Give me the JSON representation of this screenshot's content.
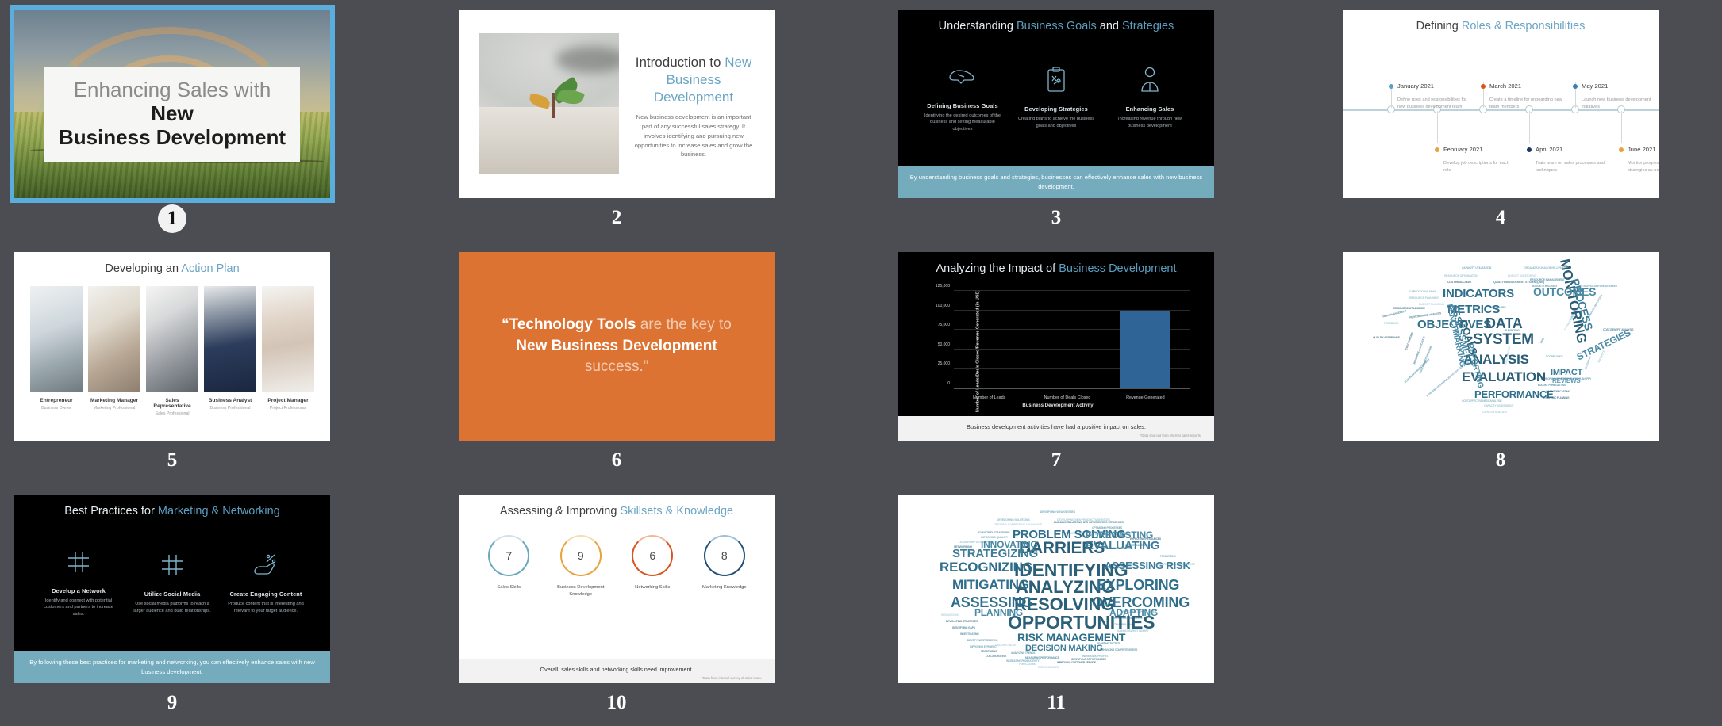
{
  "app": {
    "view": "slide-sorter",
    "background_color": "#4b4d53",
    "selection_color": "#5badde",
    "accent_color": "#6ba5c4",
    "banner_color": "#74abbd",
    "orange_color": "#dd7333"
  },
  "slides": [
    {
      "number": "1",
      "selected": true,
      "type": "title-photo",
      "title_line1_plain": "Enhancing Sales with ",
      "title_line1_bold": "New",
      "title_line2": "Business Development"
    },
    {
      "number": "2",
      "selected": false,
      "type": "image-text",
      "title_plain": "Introduction to ",
      "title_accent1": "New",
      "title_accent2": "Business Development",
      "body": "New business development is an important part of any successful sales strategy. It involves identifying and pursuing new opportunities to increase sales and grow the business."
    },
    {
      "number": "3",
      "selected": false,
      "type": "dark-three-column",
      "title_plain1": "Understanding ",
      "title_accent1": "Business Goals",
      "title_plain2": " and ",
      "title_accent2": "Strategies",
      "columns": [
        {
          "icon": "handshake-icon",
          "heading": "Defining Business Goals",
          "text": "Identifying the desired outcomes of the business and setting measurable objectives"
        },
        {
          "icon": "clipboard-strategy-icon",
          "heading": "Developing Strategies",
          "text": "Creating plans to achieve the business goals and objectives"
        },
        {
          "icon": "person-tie-icon",
          "heading": "Enhancing Sales",
          "text": "Increasing revenue through new business development"
        }
      ],
      "banner": "By understanding business goals and strategies, businesses can effectively enhance sales with new business development."
    },
    {
      "number": "4",
      "selected": false,
      "type": "timeline",
      "title_plain": "Defining ",
      "title_accent": "Roles & Responsibilities",
      "events": [
        {
          "date": "January 2021",
          "text": "Define roles and responsibilities for new business development team",
          "color": "#5b9ec0",
          "position": "above"
        },
        {
          "date": "February 2021",
          "text": "Develop job descriptions for each role",
          "color": "#e8a33d",
          "position": "below"
        },
        {
          "date": "March 2021",
          "text": "Create a timeline for onboarding new team members",
          "color": "#d9531e",
          "position": "above"
        },
        {
          "date": "April 2021",
          "text": "Train team on sales processes and techniques",
          "color": "#1f3864",
          "position": "below"
        },
        {
          "date": "May 2021",
          "text": "Launch new business development initiatives",
          "color": "#3b7fb5",
          "position": "above"
        },
        {
          "date": "June 2021",
          "text": "Monitor progress and adjust strategies as needed",
          "color": "#e8a33d",
          "position": "below"
        }
      ]
    },
    {
      "number": "5",
      "selected": false,
      "type": "team-grid",
      "title_plain": "Developing an ",
      "title_accent": "Action Plan",
      "people": [
        {
          "name": "Entrepreneur",
          "role": "Business Owner"
        },
        {
          "name": "Marketing Manager",
          "role": "Marketing Professional"
        },
        {
          "name": "Sales Representative",
          "role": "Sales Professional"
        },
        {
          "name": "Business Analyst",
          "role": "Business Professional"
        },
        {
          "name": "Project Manager",
          "role": "Project Professional"
        }
      ]
    },
    {
      "number": "6",
      "selected": false,
      "type": "quote",
      "quote_parts": [
        {
          "text": "“Technology Tools ",
          "bold": true
        },
        {
          "text": "are the key to ",
          "bold": false
        },
        {
          "text": "New Business Development",
          "bold": true
        },
        {
          "text": " success.”",
          "bold": false
        }
      ]
    },
    {
      "number": "7",
      "selected": false,
      "type": "bar-chart",
      "title_plain": "Analyzing the Impact of ",
      "title_accent": "Business Development",
      "footer": "Business development activities have had a positive impact on sales.",
      "footnote": "*Data sourced from internal sales reports."
    },
    {
      "number": "8",
      "selected": false,
      "type": "word-cloud",
      "words_large": [
        "INDICATORS",
        "METRICS",
        "OBJECTIVES",
        "DATA",
        "MONITORING",
        "PROCESS",
        "OUTCOMES",
        "SYSTEM",
        "GOALS",
        "ANALYSIS",
        "EVALUATION",
        "PERFORMANCE",
        "ASSESSMENT",
        "STRATEGIES",
        "IMPACT",
        "BENCHMARKING",
        "REPORTING",
        "REVIEWS"
      ],
      "words_small": [
        "CAPACITY UTILIZATION",
        "ORGANIZATIONAL DEVELOPMENT",
        "RESOURCE OPTIMIZATION",
        "BUDGET MONITORING",
        "COST REDUCTION",
        "QUALITY MANAGEMENT SYSTEM (QMS)",
        "RESOURCE MANAGEMENT",
        "BUDGET TRACKING",
        "STAKEHOLDER ENGAGEMENT",
        "CAPACITY BUILDING",
        "RESOURCE PLANNING",
        "BUDGET PLANNING",
        "RESOURCE UTILIZATION",
        "PERFORMANCE ANALYSIS",
        "RISK MANAGEMENT",
        "MEASURES",
        "PERFORMANCE REPORTING",
        "SURVEYS",
        "FEEDBACK",
        "CAPACITY PLANNING",
        "QUALITY ASSURANCE",
        "COST-BENEFIT ANALYSIS",
        "BUDGETING",
        "KPIS",
        "SCORECARDS",
        "PROGRAMS",
        "PROJECTS",
        "COST ANALYSIS",
        "COST CONTROL",
        "RESOURCE ALLOCATION",
        "COST-BENEFIT ANALYSIS",
        "CONTINUOUS IMPROVEMENT",
        "PERFORMANCE MANAGEMENT SYSTEM (PMS)",
        "COST-EFFECTIVENESS ANALYSIS",
        "CAPACITY ASSESSMENT",
        "CAPACITY BUILDING",
        "STRATEGIC PLANNING",
        "COST FORECASTING",
        "BUDGET FORECASTING",
        "PERFORMANCE IMPROVEMENT PLAN (PIP)"
      ]
    },
    {
      "number": "9",
      "selected": false,
      "type": "dark-three-column",
      "title_plain1": "Best Practices for ",
      "title_accent1": "Marketing & Networking",
      "title_plain2": "",
      "title_accent2": "",
      "columns": [
        {
          "icon": "hashtag-icon",
          "heading": "Develop a Network",
          "text": "Identify and connect with potential customers and partners to increase sales."
        },
        {
          "icon": "hashtag-icon",
          "heading": "Utilize Social Media",
          "text": "Use social media platforms to reach a larger audience and build relationships."
        },
        {
          "icon": "hand-content-icon",
          "heading": "Create Engaging Content",
          "text": "Produce content that is interesting and relevant to your target audience."
        }
      ],
      "banner": "By following these best practices for marketing and networking, you can effectively enhance sales with new business development."
    },
    {
      "number": "10",
      "selected": false,
      "type": "score-rings",
      "title_plain": "Assessing & Improving ",
      "title_accent": "Skillsets & Knowledge",
      "footer": "Overall, sales skills and networking skills need improvement.",
      "footnote": "*Data from internal survey of sales team."
    },
    {
      "number": "11",
      "selected": false,
      "type": "word-cloud",
      "words_large": [
        "PROBLEM SOLVING",
        "BARRIERS",
        "IDENTIFYING",
        "ANALYZING",
        "RESOLVING",
        "OPPORTUNITIES",
        "RECOGNIZING",
        "MITIGATING",
        "ASSESSING",
        "OVERCOMING",
        "EXPLORING",
        "STRATEGIZING",
        "EVALUATING",
        "FORECASTING",
        "ASSESSING RISK",
        "RISK MANAGEMENT",
        "DECISION MAKING",
        "INNOVATING",
        "PLANNING",
        "ADAPTING"
      ],
      "words_small": [
        "IDENTIFYING WEAKNESSES",
        "DEVELOPING SOLUTIONS",
        "DEVELOPING NEW PRODUCTS/SERVICES",
        "CREATING COMPETITIVE ADVANTAGE",
        "BUILDING RELATIONSHIPS",
        "IMPLEMENTING STRATEGIES",
        "ADJUSTING STRATEGIES",
        "OPTIMIZING PROCESSES",
        "IMPROVING QUALITY",
        "INCREASING MARKET SHARE",
        "LEADERSHIP DEVELOPMENT",
        "BRAINSTORMING",
        "EXPLOITING RESOURCES",
        "NETWORKING",
        "IDENTIFYING THREATS",
        "MONITORING PROGRESS",
        "PRIORITIZING",
        "MAXIMIZING BENEFITS",
        "DEVELOPING SKILLS/KNOWLEDGE",
        "RESEARCHING",
        "DEVELOPING STRATEGIES",
        "IDENTIFYING GAPS",
        "INVESTIGATING",
        "IDENTIFYING STRENGTHS",
        "MOTIVATING EMPLOYEES",
        "TEAM BUILDING",
        "GAINING MARKET INSIGHT",
        "CREATING VALUE",
        "NEGOTIATING",
        "ADAPTING TACTICS",
        "COLLABORATING",
        "ENHANCING COMPETITIVENESS",
        "INCREASING PRODUCTIVITY",
        "INCREASING PROFITS",
        "FORECASTING",
        "REDUCING COSTS",
        "IMPROVING CUSTOMER SERVICE",
        "IDENTIFYING OPPORTUNITIES",
        "MEASURING PERFORMANCE",
        "ANALYZING TRENDS",
        "IMPROVING EFFICIENCY",
        "EXPLOITING OPPORTUNITIES",
        "ANTICIPATING"
      ]
    }
  ],
  "chart_data": {
    "type": "bar",
    "title": "Analyzing the Impact of Business Development",
    "categories": [
      "Number of Leads",
      "Number of Deals Closed",
      "Revenue Generated"
    ],
    "values": [
      0,
      0,
      100000
    ],
    "xlabel": "Business Development Activity",
    "ylabel": "Number of Leads/Deals Closed/Revenue Generated (in USD)",
    "ylim": [
      0,
      125000
    ],
    "yticks": [
      "0",
      "25,000",
      "50,000",
      "75,000",
      "100,000",
      "125,000"
    ],
    "bar_color": "#2e6496",
    "grid": true,
    "legend": "none"
  },
  "rings_data": {
    "type": "bar",
    "title": "Assessing & Improving Skillsets & Knowledge",
    "categories": [
      "Sales Skills",
      "Business Development Knowledge",
      "Networking Skills",
      "Marketing Knowledge"
    ],
    "values": [
      7,
      9,
      6,
      8
    ],
    "ylim": [
      0,
      10
    ],
    "colors": [
      "#6aa8bf",
      "#e8a33d",
      "#d9531e",
      "#1f4e79"
    ]
  }
}
